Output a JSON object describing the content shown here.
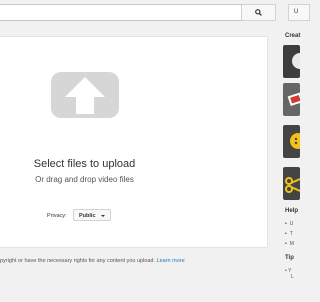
{
  "header": {
    "search_placeholder": "",
    "upload_button_label": "U"
  },
  "upload": {
    "title": "Select files to upload",
    "subtitle": "Or drag and drop video files",
    "privacy_label": "Privacy:",
    "privacy_value": "Public",
    "footer_text": "pyright or have the necessary rights for any content you upload.",
    "footer_link": "Learn more"
  },
  "sidebar": {
    "create_label": "Creat",
    "help_label": "Help",
    "help_items": [
      "U",
      "T",
      "M"
    ],
    "tip_label": "Tip",
    "tip_text_1": "Y",
    "tip_text_2": "L"
  },
  "icons": {
    "search": "search-icon",
    "upload": "upload-arrow-icon",
    "privacy_caret": "chevron-down-icon"
  }
}
